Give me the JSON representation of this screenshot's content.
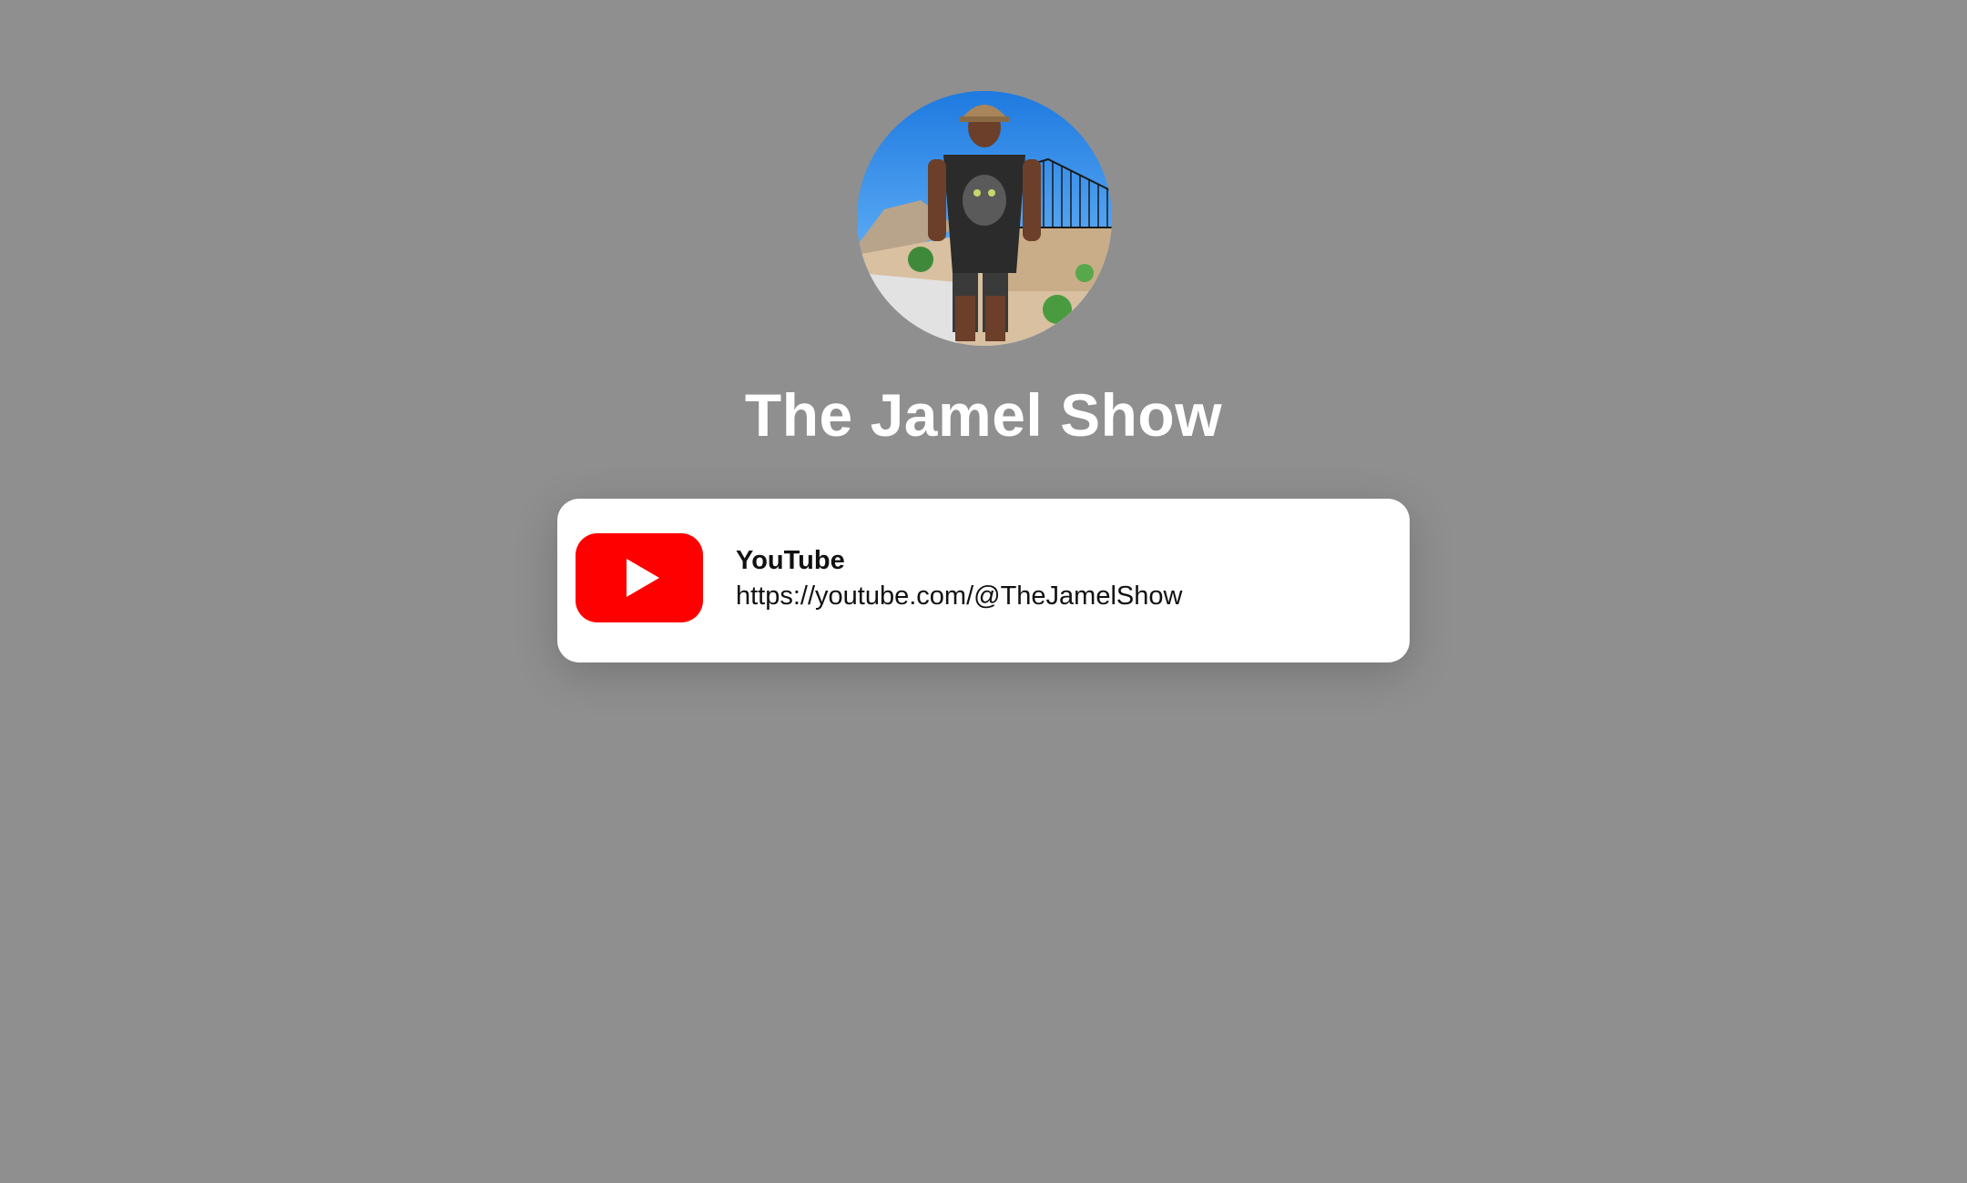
{
  "profile": {
    "title": "The Jamel Show",
    "avatar_icon": "profile-photo"
  },
  "links": [
    {
      "title": "YouTube",
      "url": "https://youtube.com/@TheJamelShow",
      "icon": "youtube-icon",
      "icon_color": "#ff0000"
    }
  ],
  "colors": {
    "background": "#8f8f8f",
    "card": "#ffffff",
    "title_text": "#ffffff",
    "card_text": "#111111"
  }
}
